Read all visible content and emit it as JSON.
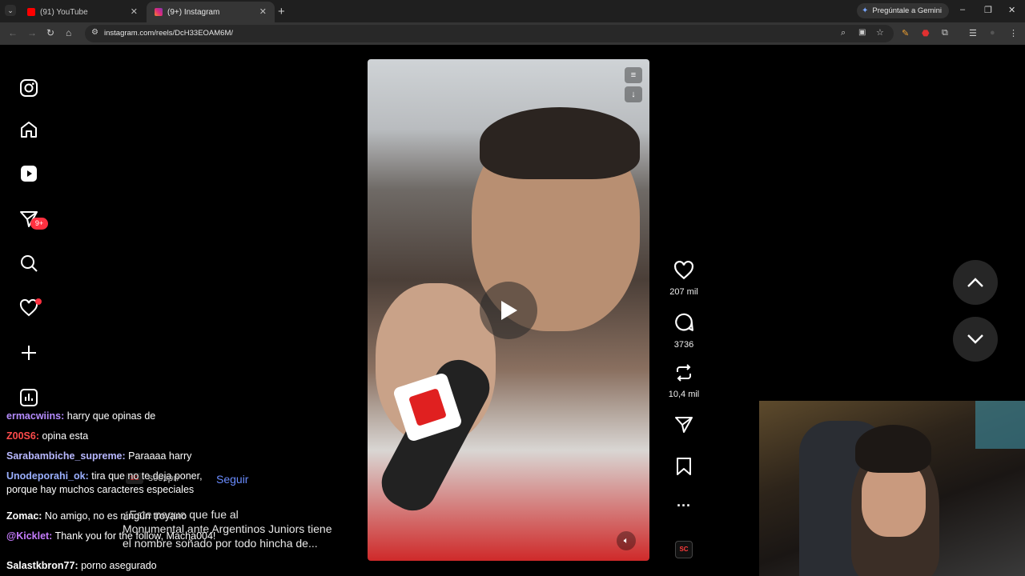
{
  "browser": {
    "tabs": [
      {
        "title": "(91) YouTube",
        "active": false,
        "favicon": "youtube-icon",
        "favicon_color": "#ff0000"
      },
      {
        "title": "(9+) Instagram",
        "active": true,
        "favicon": "instagram-icon",
        "favicon_color": "#e1306c"
      }
    ],
    "gemini_label": "Pregúntale a Gemini",
    "url": "instagram.com/reels/DcH33EOAM6M/"
  },
  "sidebar": {
    "items": [
      {
        "name": "instagram-logo",
        "icon": "instagram-icon"
      },
      {
        "name": "home",
        "icon": "home-icon"
      },
      {
        "name": "reels",
        "icon": "reels-icon"
      },
      {
        "name": "messages",
        "icon": "messages-icon"
      },
      {
        "name": "search",
        "icon": "search-icon"
      },
      {
        "name": "notifications",
        "icon": "heart-icon"
      },
      {
        "name": "create",
        "icon": "plus-icon"
      },
      {
        "name": "dashboard",
        "icon": "dashboard-icon"
      }
    ],
    "messages_badge": "9+"
  },
  "reel": {
    "likes": "207 mil",
    "comments": "3736",
    "reposts": "10,4 mil",
    "author": "scespn",
    "follow_label": "Seguir",
    "caption_lines": [
      "¿Este peque que fue al",
      "Monumental ante Argentinos Juniors tiene",
      "el nombre soñado por todo hincha de..."
    ],
    "audio_badge": "SC"
  },
  "chat": [
    {
      "user": "ermacwiins:",
      "text": "harry que opinas de",
      "color": "#b58cff"
    },
    {
      "user": "Z00S6:",
      "text": "opina esta",
      "color": "#ff4b4b"
    },
    {
      "user": "Sarabambiche_supreme:",
      "text": "Paraaaa harry",
      "color": "#b8b8ff"
    },
    {
      "user": "Unodeporahi_ok:",
      "text": "tira que no te deja poner, porque hay muchos caracteres especiales",
      "color": "#9bb0ff"
    },
    {
      "user": "Zomac:",
      "text": "No amigo, no es ningún troyano",
      "color": "#ffffff"
    },
    {
      "user": "@Kicklet:",
      "text": "Thank you for the follow, Macha004!",
      "color": "#c77dff"
    },
    {
      "user": "Salastkbron77:",
      "text": "porno asegurado",
      "color": "#ffffff"
    }
  ]
}
